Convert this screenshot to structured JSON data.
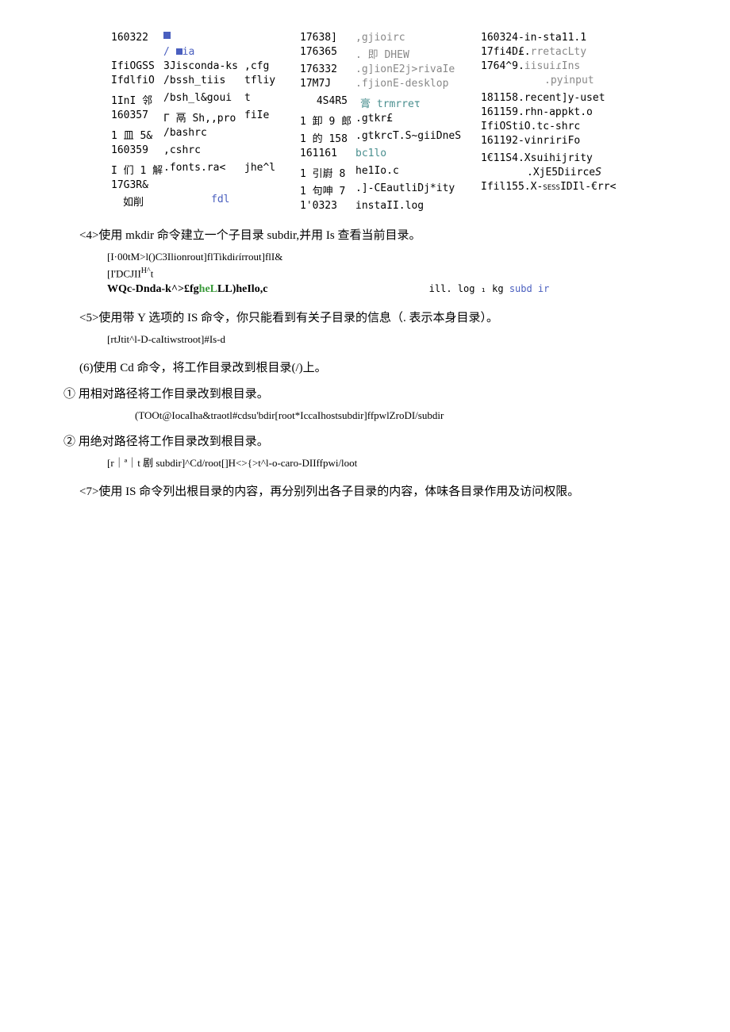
{
  "ls": {
    "col1": [
      {
        "a": "160322",
        "b": "■",
        "c": ""
      },
      {
        "a": "",
        "b": "/ ■ia",
        "c": ""
      },
      {
        "a": "IfiOGSS",
        "b": "3Jisconda-ks",
        "c": ",cfg"
      },
      {
        "a": "IfdlfiO",
        "b": "/bssh_tiis",
        "c": "tfliy"
      },
      {
        "a": "1InI 邻",
        "b": "/bsh_l&goui",
        "c": "t"
      },
      {
        "a": "160357",
        "b": "Γ 鬲 Sh,,pro",
        "c": "fiIe"
      },
      {
        "a": "1 皿 5&",
        "b": "/bashrc",
        "c": ""
      },
      {
        "a": "160359",
        "b": ",cshrc",
        "c": ""
      },
      {
        "a": "I 们 1 解",
        "b": ".fonts.ra<",
        "c": "jhe^l"
      },
      {
        "a": "17G3R&",
        "b": "",
        "c": ""
      },
      {
        "a": "如削",
        "b": "fdl",
        "c": ""
      }
    ],
    "col2": [
      {
        "a": "17638]",
        "b": ",gjioirc"
      },
      {
        "a": "176365",
        "b": ". 即 DHEW"
      },
      {
        "a": "176332",
        "b": ".g]ionE2j>rivaIe"
      },
      {
        "a": "17M7J",
        "b": ".fjionE-desklop"
      },
      {
        "a": "4S4R5",
        "b": "膏 trmrreτ"
      },
      {
        "a": "1 卸 9 郎",
        "b": ".gtkr£"
      },
      {
        "a": "1 的 158",
        "b": ".gtkrcT.S~giiDneS"
      },
      {
        "a": "161161",
        "b": "bc1lo"
      },
      {
        "a": "1 引嶎 8",
        "b": "he1Io.c"
      },
      {
        "a": "1 句呻 7",
        "b": ".]-CEautliDj*ity"
      },
      {
        "a": "1'0323",
        "b": "instaII.log"
      }
    ],
    "col3": [
      {
        "a": "160324-in-sta11.1"
      },
      {
        "a": "17fi4D£.rretacLty"
      },
      {
        "a": "1764^9.iisuiɾIns"
      },
      {
        "a": ".pyinput"
      },
      {
        "a": "181158.recent]y-uset"
      },
      {
        "a": "161159.rhn-appkt.o"
      },
      {
        "a": "IfiOStiO.tc-shrc"
      },
      {
        "a": "161192-vinririFo"
      },
      {
        "a": "1€11S4.Xsuihijrity"
      },
      {
        "a": ".XjE5DiirceS"
      },
      {
        "a": "Ifil155.X-SESSIDIl-€rr<"
      }
    ]
  },
  "narr4": "<4>使用 mkdir 命令建立一个子目录 subdir,并用 Is 查看当前目录。",
  "code4": {
    "l1": "[I·00tM>l()C3Ilionrout]flTikdiɾírrout]flI&",
    "l2": "[I'DCJIIH^t",
    "l3_pre": "WQc-Dnda-k^>£fg",
    "l3_green": "heL",
    "l3_post": "LL)heIlo,c",
    "l3_right_a": "ill. log ₁ kg ",
    "l3_right_b": "subd ir"
  },
  "narr5": "<5>使用带 Y 选项的 IS 命令，你只能看到有关子目录的信息（. 表示本身目录）。",
  "code5": "[rtJtit^l-D-caItiwstroot]#Is-d",
  "narr6": "(6)使用 Cd 命令，将工作目录改到根目录(/)上。",
  "narr6a": "①   用相对路径将工作目录改到根目录。",
  "code6a": "(TOOt@IocaIha&traotl#cdsu'bdir[root*IccaIhostsubdir]ffpwlZroDI/subdir",
  "narr6b": "②   用绝对路径将工作目录改到根目录。",
  "code6b": "[r｜ª｜t 剧 subdir]^Cd/root[]H<>{>t^l-o-caro-DIIffpwi/loot",
  "narr7": "<7>使用 IS 命令列出根目录的内容，再分别列出各子目录的内容，体味各目录作用及访问权限。"
}
